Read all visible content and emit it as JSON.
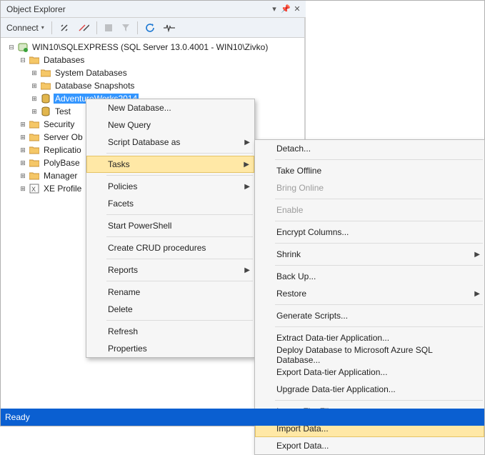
{
  "panel": {
    "title": "Object Explorer"
  },
  "toolbar": {
    "connect": "Connect"
  },
  "tree": {
    "server": "WIN10\\SQLEXPRESS (SQL Server 13.0.4001 - WIN10\\Zivko)",
    "databases": "Databases",
    "sysdb": "System Databases",
    "snapshots": "Database Snapshots",
    "aw": "AdventureWorks2014",
    "test": "Test",
    "security": "Security",
    "serverobj": "Server Ob",
    "replication": "Replicatio",
    "polybase": "PolyBase",
    "management": "Manager",
    "xe": "XE Profile"
  },
  "menu1": {
    "newdb": "New Database...",
    "newquery": "New Query",
    "script": "Script Database as",
    "tasks": "Tasks",
    "policies": "Policies",
    "facets": "Facets",
    "ps": "Start PowerShell",
    "crud": "Create CRUD procedures",
    "reports": "Reports",
    "rename": "Rename",
    "delete": "Delete",
    "refresh": "Refresh",
    "properties": "Properties"
  },
  "menu2": {
    "detach": "Detach...",
    "offline": "Take Offline",
    "online": "Bring Online",
    "enable": "Enable",
    "encrypt": "Encrypt Columns...",
    "shrink": "Shrink",
    "backup": "Back Up...",
    "restore": "Restore",
    "genscripts": "Generate Scripts...",
    "extract": "Extract Data-tier Application...",
    "deploy": "Deploy Database to Microsoft Azure SQL Database...",
    "exportdt": "Export Data-tier Application...",
    "upgrade": "Upgrade Data-tier Application...",
    "importflat": "Import Flat File...",
    "importdata": "Import Data...",
    "exportdata": "Export Data..."
  },
  "status": {
    "text": "Ready"
  }
}
